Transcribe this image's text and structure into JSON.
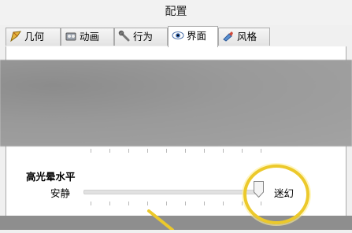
{
  "window": {
    "title": "配置"
  },
  "tabs": [
    {
      "label": "几何",
      "icon": "geometry-icon",
      "active": false
    },
    {
      "label": "动画",
      "icon": "animation-icon",
      "active": false
    },
    {
      "label": "行为",
      "icon": "behavior-icon",
      "active": false
    },
    {
      "label": "界面",
      "icon": "eye-icon",
      "active": true
    },
    {
      "label": "风格",
      "icon": "style-icon",
      "active": false
    }
  ],
  "highlight_slider": {
    "title": "高光晕水平",
    "min_label": "安静",
    "max_label": "迷幻",
    "value_fraction": 1.0
  },
  "colors": {
    "highlight_ring": "#ecc92b",
    "gray_band": "#999999"
  }
}
